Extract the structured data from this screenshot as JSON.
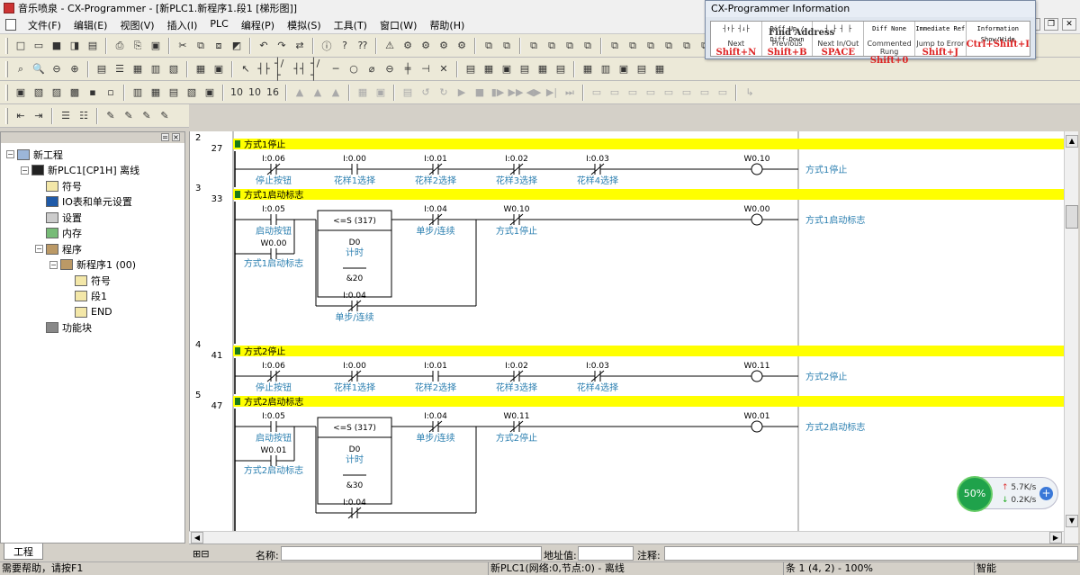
{
  "window": {
    "title": "音乐喷泉 - CX-Programmer - [新PLC1.新程序1.段1 [梯形图]]"
  },
  "menu": [
    "文件(F)",
    "编辑(E)",
    "视图(V)",
    "插入(I)",
    "PLC",
    "编程(P)",
    "模拟(S)",
    "工具(T)",
    "窗口(W)",
    "帮助(H)"
  ],
  "toolbars": [
    {
      "groups": [
        [
          "□",
          "▭",
          "■",
          "◨",
          "▤"
        ],
        [
          "⎙",
          "⎘",
          "▣"
        ],
        [
          "✂",
          "⧉",
          "⧈",
          "◩"
        ],
        [
          "↶",
          "↷",
          "⇄"
        ],
        [
          "ⓘ",
          "?",
          "⁇"
        ],
        [
          "⚠",
          "⚙",
          "⚙",
          "⚙",
          "⚙"
        ],
        [
          "⧉",
          "⧉"
        ],
        [
          "⧉",
          "⧉",
          "⧉",
          "⧉"
        ],
        [
          "⧉",
          "⧉",
          "⧉",
          "⧉",
          "⧉",
          "⧉",
          "⧉",
          "⧉",
          "⧉"
        ]
      ]
    },
    {
      "groups": [
        [
          "⌕",
          "🔍",
          "⊖",
          "⊕"
        ],
        [
          "▤",
          "☰",
          "▦",
          "▥",
          "▧"
        ],
        [
          "▦",
          "▣"
        ],
        [
          "↖",
          "┤├",
          "┤/├",
          "┤┤",
          "┤/┤",
          "─",
          "○",
          "⌀",
          "⊖",
          "╪",
          "⊣",
          "✕"
        ],
        [
          "▤",
          "▦",
          "▣",
          "▤",
          "▦",
          "▤"
        ],
        [
          "▦",
          "▥",
          "▣",
          "▤",
          "▦"
        ]
      ]
    },
    {
      "groups": [
        [
          "▣",
          "▧",
          "▨",
          "▩",
          "▪",
          "▫"
        ],
        [
          "▥",
          "▦",
          "▤",
          "▧",
          "▣"
        ],
        [
          "10",
          "10",
          "16"
        ],
        [
          "▲",
          "▲",
          "▲"
        ],
        [
          "▦",
          "▣"
        ],
        [
          "▤",
          "↺",
          "↻",
          "▶",
          "■",
          "▮▶",
          "▶▶",
          "◀▶",
          "▶|",
          "⏭"
        ],
        [
          "▭",
          "▭",
          "▭",
          "▭",
          "▭",
          "▭",
          "▭",
          "▭"
        ],
        [
          "↳"
        ]
      ]
    },
    {
      "groups": [
        [
          "⇤",
          "⇥"
        ],
        [
          "☰",
          "☷"
        ],
        [
          "✎",
          "✎",
          "✎",
          "✎"
        ]
      ]
    }
  ],
  "project_tree": [
    {
      "label": "新工程",
      "level": 0,
      "expander": "−",
      "icon": "net"
    },
    {
      "label": "新PLC1[CP1H] 离线",
      "level": 1,
      "expander": "−",
      "icon": "plc"
    },
    {
      "label": "符号",
      "level": 2,
      "expander": "",
      "icon": "sym"
    },
    {
      "label": "IO表和单元设置",
      "level": 2,
      "expander": "",
      "icon": "io"
    },
    {
      "label": "设置",
      "level": 2,
      "expander": "",
      "icon": "set"
    },
    {
      "label": "内存",
      "level": 2,
      "expander": "",
      "icon": "mem"
    },
    {
      "label": "程序",
      "level": 2,
      "expander": "−",
      "icon": "prg"
    },
    {
      "label": "新程序1 (00)",
      "level": 3,
      "expander": "−",
      "icon": "prg"
    },
    {
      "label": "符号",
      "level": 4,
      "expander": "",
      "icon": "sym"
    },
    {
      "label": "段1",
      "level": 4,
      "expander": "",
      "icon": "sym"
    },
    {
      "label": "END",
      "level": 4,
      "expander": "",
      "icon": "sym"
    },
    {
      "label": "功能块",
      "level": 2,
      "expander": "",
      "icon": "fb"
    }
  ],
  "left_tab": "工程",
  "rungs": [
    {
      "number": "2",
      "step": "27",
      "comment": "方式1停止",
      "contacts": [
        {
          "addr": "I:0.06",
          "comment": "停止按钮",
          "nc": true
        },
        {
          "addr": "I:0.00",
          "comment": "花样1选择",
          "nc": false
        },
        {
          "addr": "I:0.01",
          "comment": "花样2选择",
          "nc": true
        },
        {
          "addr": "I:0.02",
          "comment": "花样3选择",
          "nc": true
        },
        {
          "addr": "I:0.03",
          "comment": "花样4选择",
          "nc": true
        }
      ],
      "coil": {
        "addr": "W0.10",
        "comment": "方式1停止"
      }
    },
    {
      "number": "3",
      "step": "33",
      "comment": "方式1启动标志",
      "contacts": [
        {
          "addr": "I:0.05",
          "comment": "启动按钮",
          "nc": false
        },
        {
          "addr": "I:0.04",
          "comment": "单步/连续",
          "nc": true
        },
        {
          "addr": "W0.10",
          "comment": "方式1停止",
          "nc": true
        }
      ],
      "parallel": {
        "addr": "W0.00",
        "comment": "方式1启动标志"
      },
      "block": {
        "title": "<=S (317)",
        "op1": "D0",
        "op1_comment": "计时",
        "op2": "&20"
      },
      "block_bypass": {
        "addr": "I:0.04",
        "comment": "单步/连续"
      },
      "coil": {
        "addr": "W0.00",
        "comment": "方式1启动标志"
      }
    },
    {
      "number": "4",
      "step": "41",
      "comment": "方式2停止",
      "contacts": [
        {
          "addr": "I:0.06",
          "comment": "停止按钮",
          "nc": true
        },
        {
          "addr": "I:0.00",
          "comment": "花样1选择",
          "nc": true
        },
        {
          "addr": "I:0.01",
          "comment": "花样2选择",
          "nc": false
        },
        {
          "addr": "I:0.02",
          "comment": "花样3选择",
          "nc": true
        },
        {
          "addr": "I:0.03",
          "comment": "花样4选择",
          "nc": true
        }
      ],
      "coil": {
        "addr": "W0.11",
        "comment": "方式2停止"
      }
    },
    {
      "number": "5",
      "step": "47",
      "comment": "方式2启动标志",
      "contacts": [
        {
          "addr": "I:0.05",
          "comment": "启动按钮",
          "nc": false
        },
        {
          "addr": "I:0.04",
          "comment": "单步/连续",
          "nc": true
        },
        {
          "addr": "W0.11",
          "comment": "方式2停止",
          "nc": true
        }
      ],
      "parallel": {
        "addr": "W0.01",
        "comment": "方式2启动标志"
      },
      "block": {
        "title": "<=S (317)",
        "op1": "D0",
        "op1_comment": "计时",
        "op2": "&30"
      },
      "block_bypass": {
        "addr": "I:0.04",
        "comment": ""
      },
      "coil": {
        "addr": "W0.01",
        "comment": "方式2启动标志"
      }
    }
  ],
  "infobar": {
    "name_label": "名称:",
    "address_label": "地址值:",
    "comment_label": "注释:"
  },
  "status": {
    "help": "需要帮助，请按F1",
    "plc": "新PLC1(网络:0,节点:0) - 离线",
    "position": "条 1 (4, 2)  - 100%",
    "mode": "智能"
  },
  "info_window": {
    "title": "CX-Programmer Information",
    "cells": [
      {
        "symbol": "┤↑├ ┤↓├",
        "key": "Next",
        "shortcut": "Shift+N"
      },
      {
        "symbol": "Diff-Up / Diff-Down",
        "key": "Previous",
        "shortcut": "Shift+B"
      },
      {
        "symbol": "┤ ├ ┤ ├",
        "key": "Next In/Out",
        "shortcut": "SPACE"
      },
      {
        "symbol": "Diff None",
        "key": "Commented Rung",
        "shortcut": "Shift+0"
      },
      {
        "symbol": "Immediate Ref",
        "key": "Jump to Error",
        "shortcut": "Shift+J"
      },
      {
        "symbol": "Information Show/Hide",
        "key": "",
        "shortcut": "Ctrl+Shift+I"
      }
    ],
    "overlay_text": "Find Address"
  },
  "speed_widget": {
    "percent": "50%",
    "up": "5.7K/s",
    "down": "0.2K/s"
  },
  "colors": {
    "rung_comment_bg": "#ffff00",
    "ladder_line": "#000000",
    "comment_text": "#2b7fb0",
    "address_text": "#000000"
  }
}
